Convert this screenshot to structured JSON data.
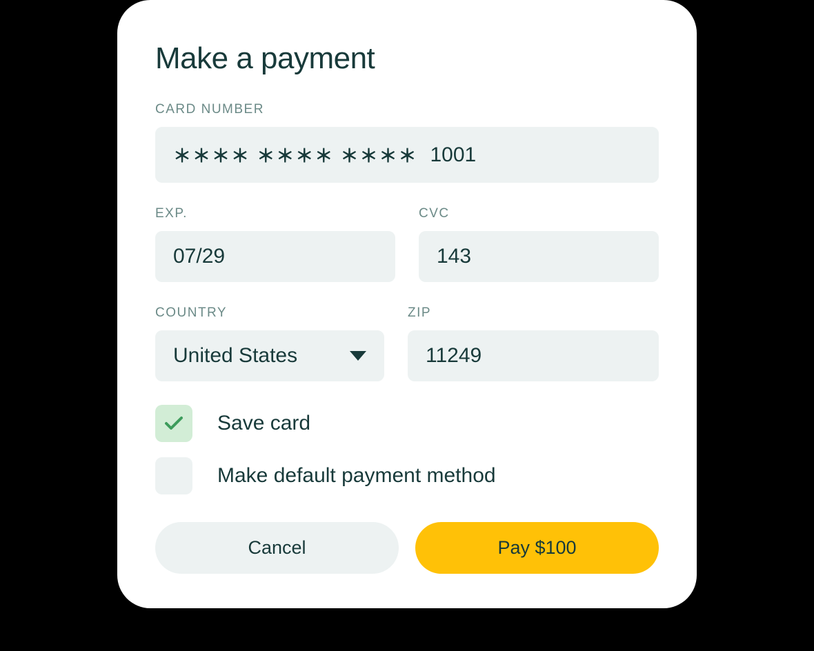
{
  "title": "Make a payment",
  "card_number": {
    "label": "CARD NUMBER",
    "masked": "＊＊＊＊ ＊＊＊＊ ＊＊＊＊",
    "last_digits": "1001"
  },
  "exp": {
    "label": "EXP.",
    "value": "07/29"
  },
  "cvc": {
    "label": "CVC",
    "value": "143"
  },
  "country": {
    "label": "COUNTRY",
    "value": "United States"
  },
  "zip": {
    "label": "ZIP",
    "value": "11249"
  },
  "save_card": {
    "label": "Save card",
    "checked": true
  },
  "make_default": {
    "label": "Make default payment method",
    "checked": false
  },
  "buttons": {
    "cancel": "Cancel",
    "pay": "Pay $100"
  }
}
